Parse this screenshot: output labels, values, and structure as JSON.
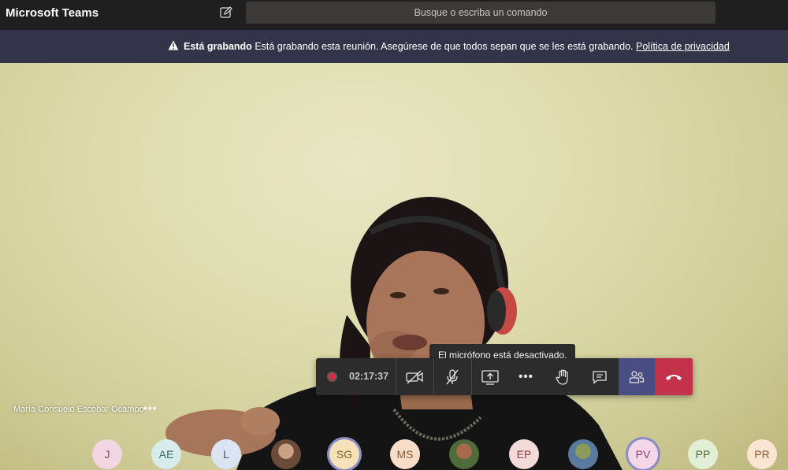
{
  "app": {
    "title": "Microsoft Teams"
  },
  "search": {
    "placeholder": "Busque o escriba un comando",
    "icon": "compose-icon"
  },
  "banner": {
    "title": "Está grabando",
    "message": "Está grabando esta reunión. Asegúrese de que todos sepan que se les está grabando.",
    "link": "Política de privacidad",
    "icon": "warning-icon"
  },
  "video": {
    "participant_name": "María Consuelo Escobar Ocampo",
    "more_label": "•••"
  },
  "tooltip": {
    "text": "El micrófono está desactivado."
  },
  "controls": {
    "timer": "02:17:37",
    "more_label": "•••",
    "colors": {
      "people": "#4a4d84",
      "hangup": "#c4314b",
      "record": "#d92c40"
    }
  },
  "participants": [
    {
      "initials": "J",
      "color": "#f2d7e2",
      "text_color": "#8a4b62"
    },
    {
      "initials": "AE",
      "color": "#d8ecec",
      "text_color": "#3b6b6b"
    },
    {
      "initials": "L",
      "color": "#dbe4f2",
      "text_color": "#44597d"
    },
    {
      "initials": "",
      "photo": true
    },
    {
      "initials": "SG",
      "color": "#f6e1b8",
      "text_color": "#86622a",
      "ring": true
    },
    {
      "initials": "MS",
      "color": "#f8dec8",
      "text_color": "#8a5a35"
    },
    {
      "initials": "",
      "photo": true
    },
    {
      "initials": "EP",
      "color": "#f5dada",
      "text_color": "#8a4444"
    },
    {
      "initials": "",
      "photo": true
    },
    {
      "initials": "PV",
      "color": "#f3d6e8",
      "text_color": "#844570",
      "ring": true
    },
    {
      "initials": "PP",
      "color": "#e2efd7",
      "text_color": "#52703a"
    },
    {
      "initials": "PR",
      "color": "#fbe4d2",
      "text_color": "#8d5d35"
    }
  ]
}
